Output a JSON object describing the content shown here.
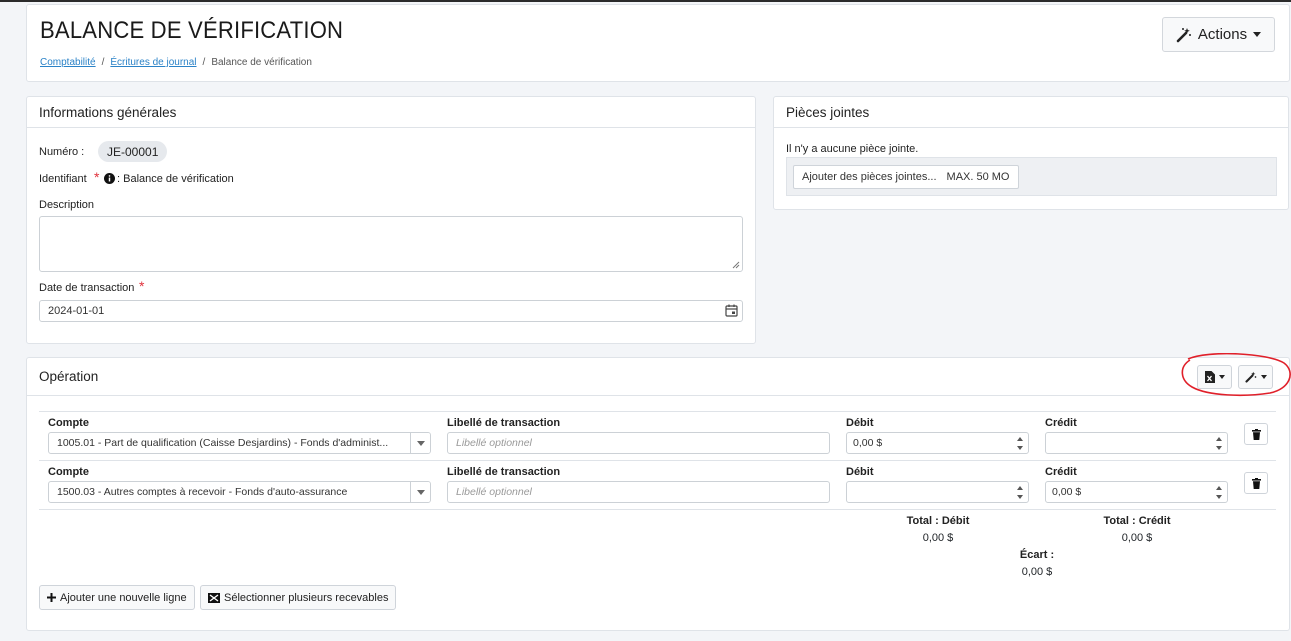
{
  "header": {
    "title": "BALANCE DE VÉRIFICATION",
    "breadcrumb": [
      "Comptabilité",
      "Écritures de journal",
      "Balance de vérification"
    ],
    "actions_label": "Actions"
  },
  "info": {
    "title": "Informations générales",
    "numero_label": "Numéro :",
    "numero_value": "JE-00001",
    "identifiant_label": "Identifiant",
    "identifiant_value": ": Balance de vérification",
    "description_label": "Description",
    "date_label": "Date de transaction",
    "date_value": "2024-01-01"
  },
  "attachments": {
    "title": "Pièces jointes",
    "empty_text": "Il n'y a aucune pièce jointe.",
    "add_label": "Ajouter des pièces jointes...",
    "max_label": "MAX. 50 MO"
  },
  "operation": {
    "title": "Opération",
    "headers": {
      "account": "Compte",
      "label": "Libellé de transaction",
      "debit": "Débit",
      "credit": "Crédit"
    },
    "rows": [
      {
        "account": "1005.01 - Part de qualification (Caisse Desjardins) - Fonds d'administ...",
        "label_placeholder": "Libellé optionnel",
        "debit": "0,00 $",
        "credit": ""
      },
      {
        "account": "1500.03 - Autres comptes à recevoir - Fonds d'auto-assurance",
        "label_placeholder": "Libellé optionnel",
        "debit": "",
        "credit": "0,00 $"
      }
    ],
    "totals": {
      "debit_label": "Total : Débit",
      "debit_value": "0,00 $",
      "credit_label": "Total : Crédit",
      "credit_value": "0,00 $",
      "gap_label": "Écart :",
      "gap_value": "0,00 $"
    },
    "add_line_label": "Ajouter une nouvelle ligne",
    "select_many_label": "Sélectionner plusieurs recevables"
  },
  "colors": {
    "annotation": "#e0202a",
    "link": "#2a82c7",
    "required": "#e0323c"
  }
}
